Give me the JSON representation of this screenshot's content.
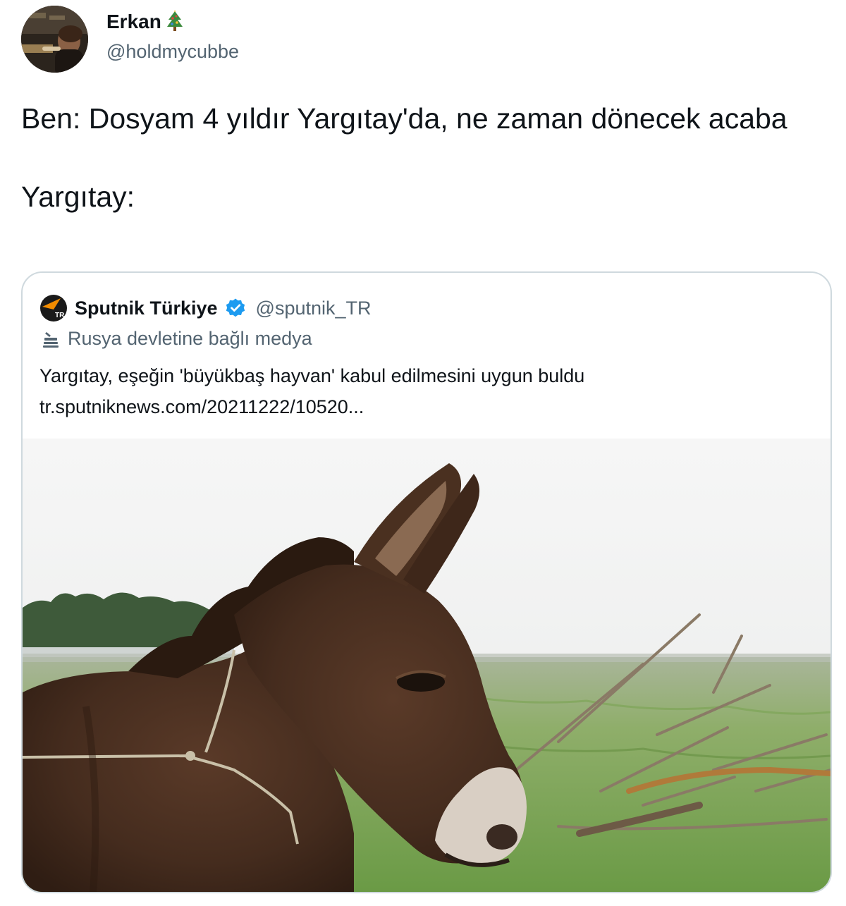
{
  "author": {
    "name": "Erkan",
    "name_emoji": "christmas-tree-icon",
    "handle": "@holdmycubbe"
  },
  "tweet": {
    "line1": "Ben: Dosyam 4 yıldır Yargıtay'da, ne zaman dönecek acaba",
    "line2": "Yargıtay:"
  },
  "quoted": {
    "name": "Sputnik Türkiye",
    "verified": true,
    "handle": "@sputnik_TR",
    "label": "Rusya devletine bağlı medya",
    "text": "Yargıtay, eşeğin 'büyükbaş hayvan' kabul edilmesini uygun buldu",
    "link": "tr.sputniknews.com/20211222/10520...",
    "logo_text": "TR",
    "media": "donkey-photo"
  },
  "colors": {
    "text_primary": "#0f1419",
    "text_secondary": "#536471",
    "border": "#cfd9de",
    "verified_blue": "#1d9bf0",
    "sputnik_orange": "#f28c00"
  }
}
